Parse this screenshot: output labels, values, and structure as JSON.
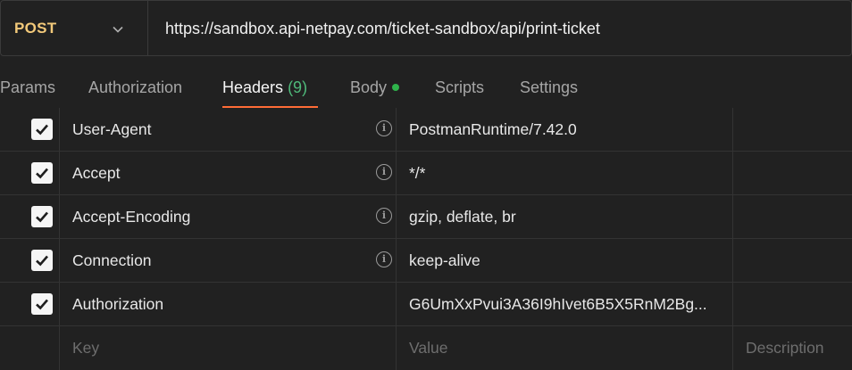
{
  "request": {
    "method": "POST",
    "url": "https://sandbox.api-netpay.com/ticket-sandbox/api/print-ticket"
  },
  "tabs": [
    {
      "label": "Params"
    },
    {
      "label": "Authorization"
    },
    {
      "label": "Headers",
      "count": "(9)"
    },
    {
      "label": "Body"
    },
    {
      "label": "Scripts"
    },
    {
      "label": "Settings"
    }
  ],
  "headers": [
    {
      "key": "User-Agent",
      "value": "PostmanRuntime/7.42.0",
      "checked": true
    },
    {
      "key": "Accept",
      "value": "*/*",
      "checked": true
    },
    {
      "key": "Accept-Encoding",
      "value": "gzip, deflate, br",
      "checked": true
    },
    {
      "key": "Connection",
      "value": "keep-alive",
      "checked": true
    },
    {
      "key": "Authorization",
      "value": "G6UmXxPvui3A36I9hIvet6B5X5RnM2Bg...",
      "checked": true
    }
  ],
  "placeholders": {
    "key": "Key",
    "value": "Value",
    "description": "Description"
  },
  "colors": {
    "method": "#f2c97a",
    "accent": "#ff6c37",
    "count": "#4fba7a",
    "body_dot": "#2fb34b"
  }
}
